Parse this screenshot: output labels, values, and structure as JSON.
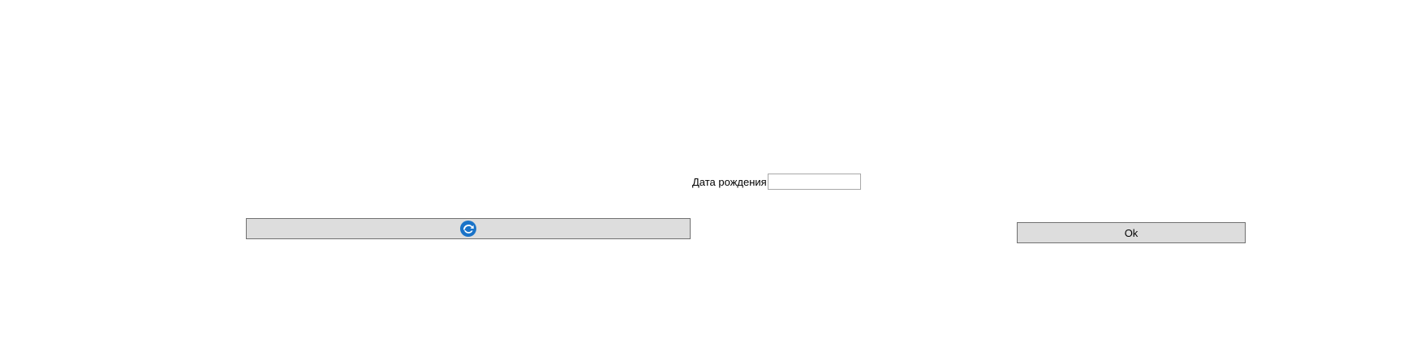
{
  "form": {
    "birth_date_label": "Дата рождения",
    "birth_date_value": "",
    "birth_date_placeholder": ""
  },
  "buttons": {
    "icon_button_icon": "refresh-icon",
    "ok_label": "Ok"
  },
  "colors": {
    "icon_blue": "#1a73c8",
    "button_bg": "#dddddd",
    "button_border": "#707070",
    "input_border": "#a8a8a8"
  }
}
